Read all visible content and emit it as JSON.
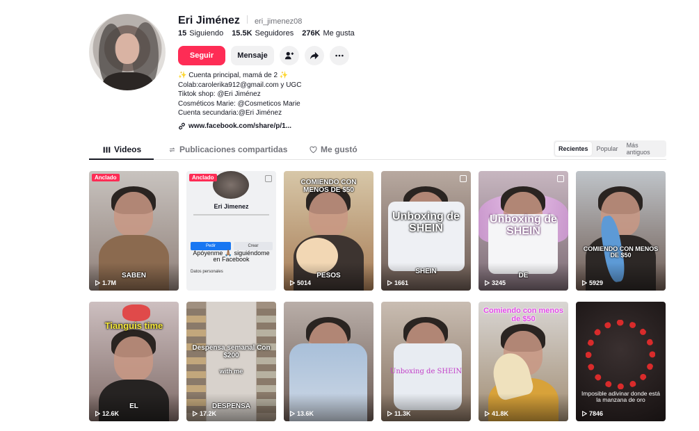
{
  "profile": {
    "name": "Eri Jiménez",
    "handle": "eri_jimenez08",
    "stats": [
      {
        "value": "15",
        "label": "Siguiendo"
      },
      {
        "value": "15.5K",
        "label": "Seguidores"
      },
      {
        "value": "276K",
        "label": "Me gusta"
      }
    ],
    "follow_label": "Seguir",
    "message_label": "Mensaje",
    "bio": [
      "✨ Cuenta principal, mamá de 2 ✨",
      "Colab:carolerika912@gmail.com y UGC",
      "Tiktok shop: @Eri Jiménez",
      "Cosméticos Marie: @Cosmeticos Marie",
      "Cuenta secundaria:@Eri Jiménez"
    ],
    "link": "www.facebook.com/share/p/1..."
  },
  "tabs": [
    "Videos",
    "Publicaciones compartidas",
    "Me gustó"
  ],
  "sort": [
    "Recientes",
    "Popular",
    "Más antiguos"
  ],
  "colors": {
    "accent": "#fe2c55"
  },
  "videos": [
    {
      "views": "1.7M",
      "badge": "Anclado",
      "caption": "SABEN",
      "overlay": ""
    },
    {
      "views": "",
      "badge": "Anclado",
      "caption": "",
      "overlay": "Apóyenme 🙏🏽 siguiéndome en Facebook",
      "fb": {
        "name": "Eri Jimenez",
        "btn1": "Pedir",
        "btn2": "Crear",
        "footer": "Datos personales"
      }
    },
    {
      "views": "5014",
      "badge": "",
      "caption": "PESOS",
      "overlay": "COMIENDO CON MENOS DE $50"
    },
    {
      "views": "1661",
      "badge": "",
      "caption": "SHEIN",
      "overlay": "Unboxing de SHEIN"
    },
    {
      "views": "3245",
      "badge": "",
      "caption": "DE",
      "overlay": "Unboxing de SHEIN"
    },
    {
      "views": "5929",
      "badge": "",
      "caption": "",
      "overlay": "COMIENDO CON MENOS DE $50"
    },
    {
      "views": "12.6K",
      "badge": "",
      "caption": "EL",
      "overlay": "Tianguis time"
    },
    {
      "views": "17.2K",
      "badge": "",
      "caption": "DESPENSA",
      "overlay": "Despensa semanal Con $200",
      "overlay2": "with me"
    },
    {
      "views": "13.6K",
      "badge": "",
      "caption": "",
      "overlay": ""
    },
    {
      "views": "11.3K",
      "badge": "",
      "caption": "",
      "overlay": "Unboxing de SHEIN"
    },
    {
      "views": "41.8K",
      "badge": "",
      "caption": "",
      "overlay": "Comiendo con menos de $50"
    },
    {
      "views": "7846",
      "badge": "",
      "caption": "",
      "overlay": "Imposible adivinar donde está la manzana de oro"
    }
  ]
}
